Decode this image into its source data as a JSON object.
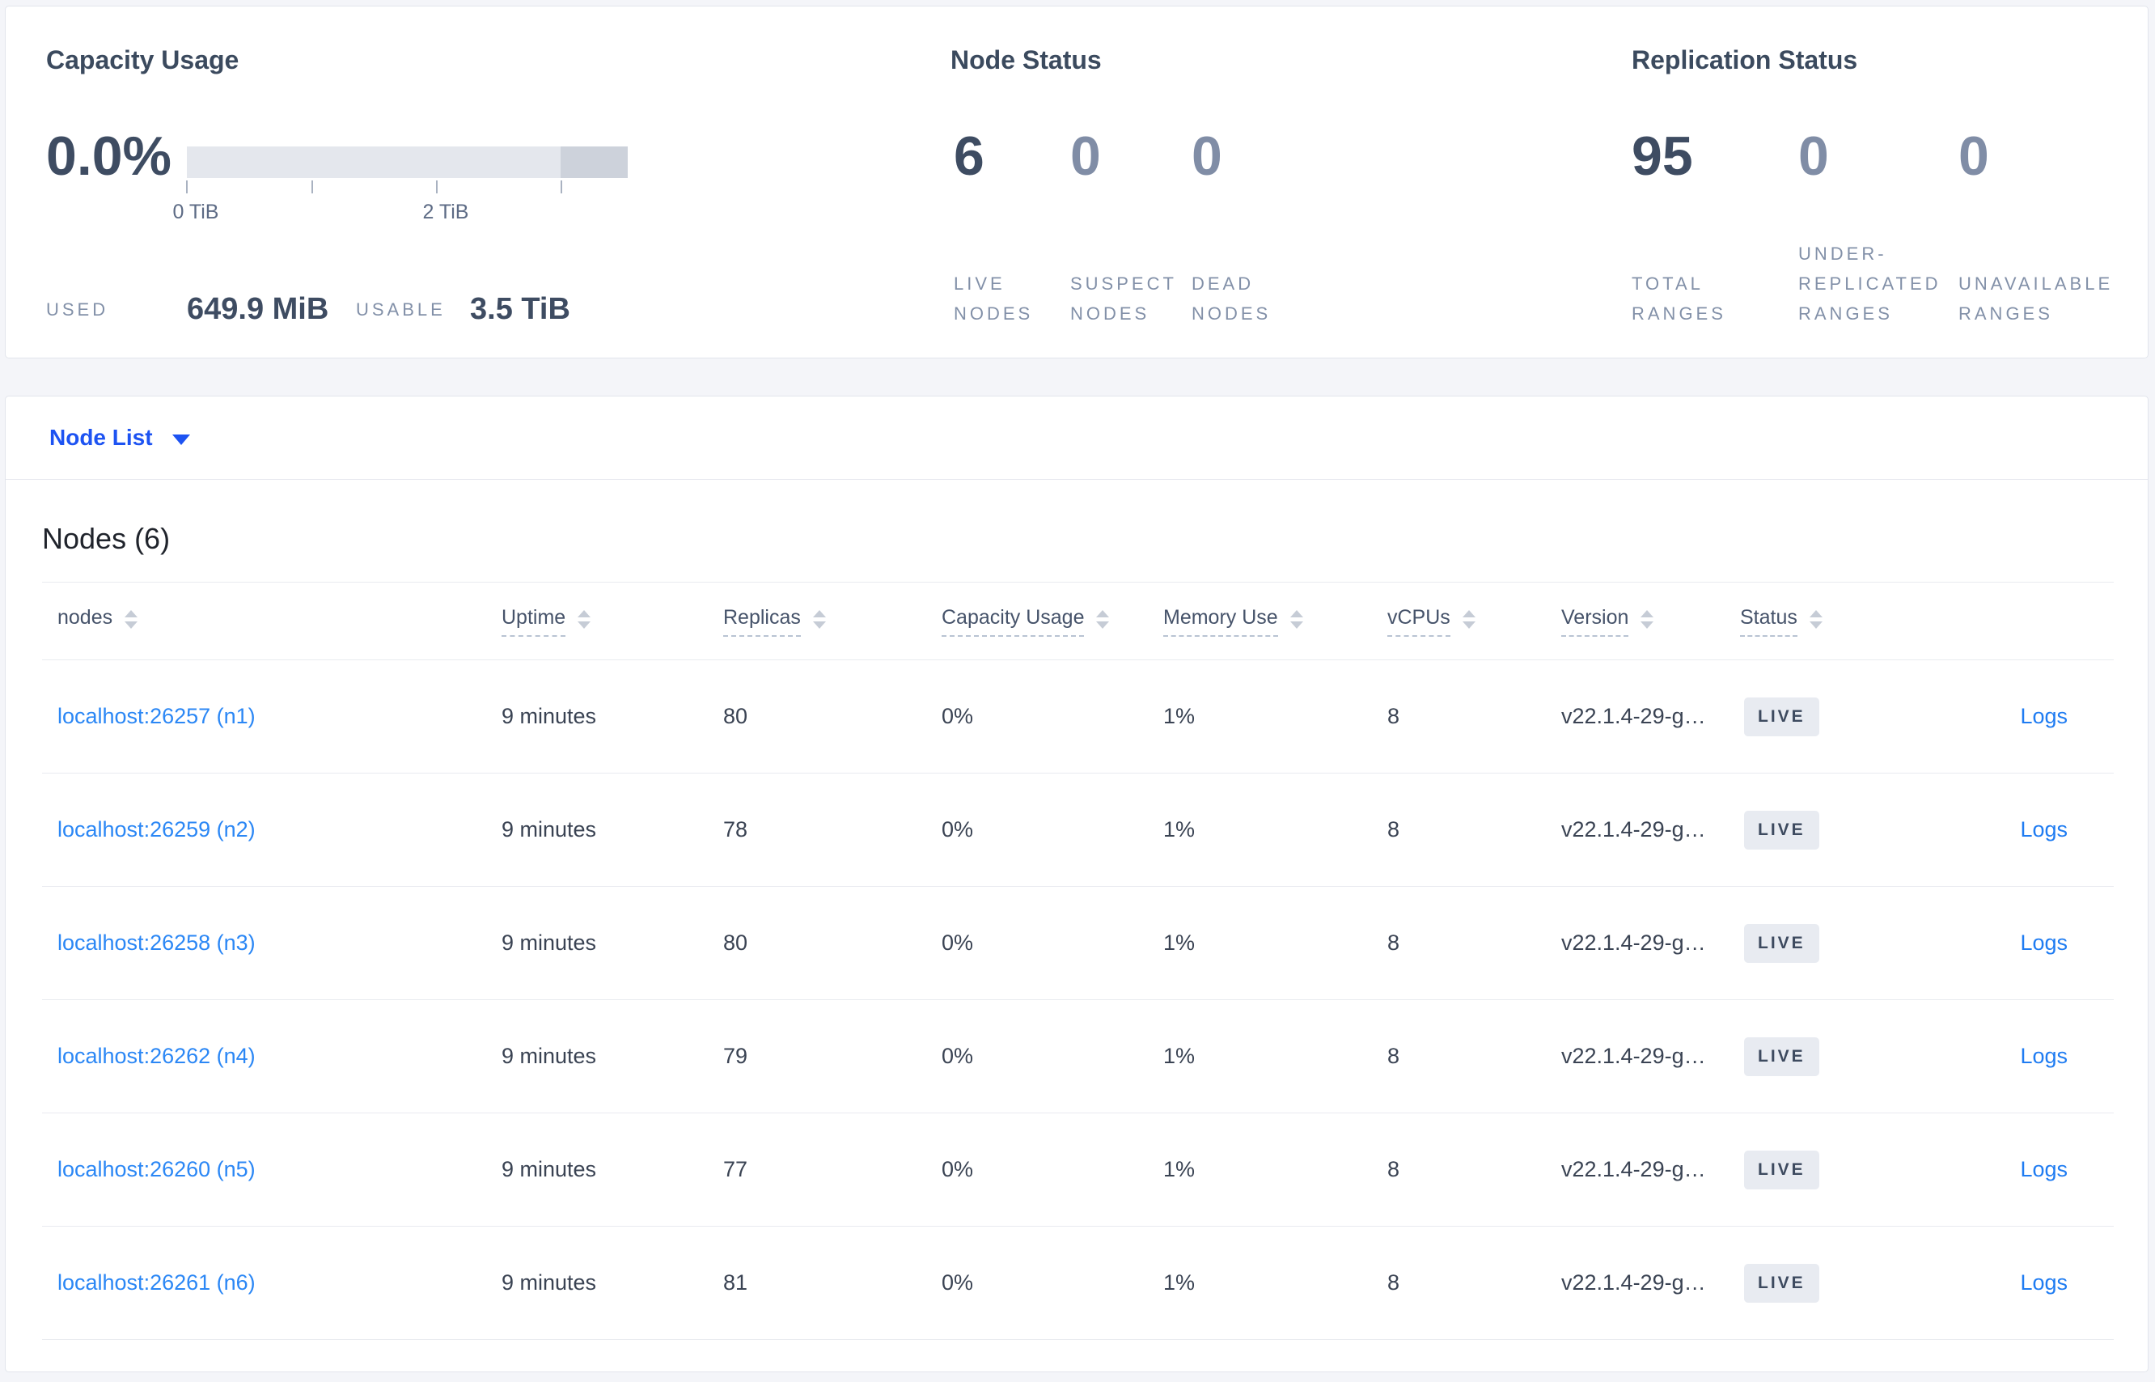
{
  "page": {
    "background": "#f4f5f9"
  },
  "summary_cards": {
    "capacity": {
      "title": "Capacity Usage",
      "percent": "0.0%",
      "axis_ticks": [
        "0 TiB",
        "2 TiB"
      ],
      "used_label": "USED",
      "used_value": "649.9 MiB",
      "usable_label": "USABLE",
      "usable_value": "3.5 TiB",
      "bar": {
        "track_color": "#e4e7ed",
        "tail_color": "#cdd2db",
        "tail_fraction": 0.152
      }
    },
    "node_status": {
      "title": "Node Status",
      "metrics": [
        {
          "value": "6",
          "lines": [
            "LIVE",
            "NODES"
          ],
          "emphasis": true
        },
        {
          "value": "0",
          "lines": [
            "SUSPECT",
            "NODES"
          ],
          "emphasis": false
        },
        {
          "value": "0",
          "lines": [
            "DEAD",
            "NODES"
          ],
          "emphasis": false
        }
      ]
    },
    "replication_status": {
      "title": "Replication Status",
      "metrics": [
        {
          "value": "95",
          "lines": [
            "TOTAL",
            "RANGES"
          ],
          "emphasis": true
        },
        {
          "value": "0",
          "lines": [
            "UNDER-",
            "REPLICATED",
            "RANGES"
          ],
          "emphasis": false
        },
        {
          "value": "0",
          "lines": [
            "UNAVAILABLE",
            "RANGES"
          ],
          "emphasis": false
        }
      ]
    }
  },
  "view_selector": {
    "label": "Node List",
    "icon": "caret-down-icon"
  },
  "nodes_table": {
    "title": "Nodes (6)",
    "columns": [
      {
        "label": "nodes",
        "dashed": false
      },
      {
        "label": "Uptime",
        "dashed": true
      },
      {
        "label": "Replicas",
        "dashed": true
      },
      {
        "label": "Capacity Usage",
        "dashed": true
      },
      {
        "label": "Memory Use",
        "dashed": true
      },
      {
        "label": "vCPUs",
        "dashed": true
      },
      {
        "label": "Version",
        "dashed": true
      },
      {
        "label": "Status",
        "dashed": true
      }
    ],
    "rows": [
      {
        "address": "localhost:26257 (n1)",
        "uptime": "9 minutes",
        "replicas": "80",
        "capacity": "0%",
        "memory": "1%",
        "vcpus": "8",
        "version": "v22.1.4-29-g…",
        "status": "LIVE",
        "logs": "Logs"
      },
      {
        "address": "localhost:26259 (n2)",
        "uptime": "9 minutes",
        "replicas": "78",
        "capacity": "0%",
        "memory": "1%",
        "vcpus": "8",
        "version": "v22.1.4-29-g…",
        "status": "LIVE",
        "logs": "Logs"
      },
      {
        "address": "localhost:26258 (n3)",
        "uptime": "9 minutes",
        "replicas": "80",
        "capacity": "0%",
        "memory": "1%",
        "vcpus": "8",
        "version": "v22.1.4-29-g…",
        "status": "LIVE",
        "logs": "Logs"
      },
      {
        "address": "localhost:26262 (n4)",
        "uptime": "9 minutes",
        "replicas": "79",
        "capacity": "0%",
        "memory": "1%",
        "vcpus": "8",
        "version": "v22.1.4-29-g…",
        "status": "LIVE",
        "logs": "Logs"
      },
      {
        "address": "localhost:26260 (n5)",
        "uptime": "9 minutes",
        "replicas": "77",
        "capacity": "0%",
        "memory": "1%",
        "vcpus": "8",
        "version": "v22.1.4-29-g…",
        "status": "LIVE",
        "logs": "Logs"
      },
      {
        "address": "localhost:26261 (n6)",
        "uptime": "9 minutes",
        "replicas": "81",
        "capacity": "0%",
        "memory": "1%",
        "vcpus": "8",
        "version": "v22.1.4-29-g…",
        "status": "LIVE",
        "logs": "Logs"
      }
    ]
  },
  "colors": {
    "primary_link": "#1d53f2",
    "table_link": "#2b87f5",
    "badge_bg": "#e8ebf1",
    "badge_text": "#3d4a5f",
    "emphasis_number": "#3e4c62",
    "muted_number": "#808da6",
    "muted_label": "#8290a8"
  }
}
